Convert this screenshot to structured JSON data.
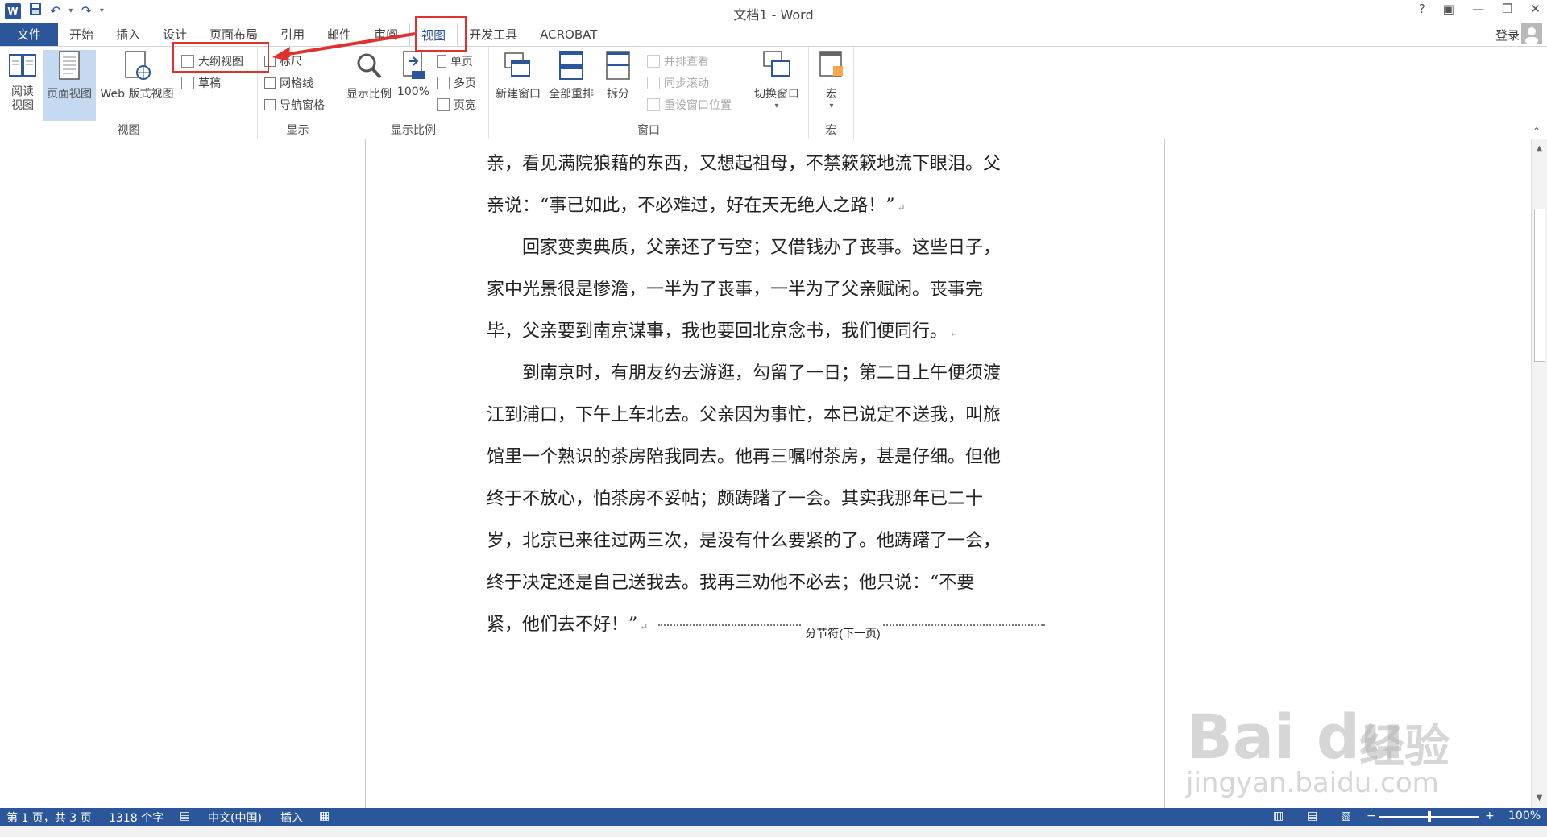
{
  "title_bar": {
    "window_title": "文档1 - Word",
    "help": "?",
    "ribbon_display": "▣",
    "minimize": "—",
    "restore": "❐",
    "close": "✕",
    "qat_undo": "↶",
    "qat_redo": "↷",
    "qat_customize": "▾",
    "logo_letter": "W"
  },
  "tabs": {
    "file": "文件",
    "items": [
      "开始",
      "插入",
      "设计",
      "页面布局",
      "引用",
      "邮件",
      "审阅",
      "视图",
      "开发工具",
      "ACROBAT"
    ],
    "active": "视图",
    "login": "登录"
  },
  "ribbon": {
    "views_group": {
      "label": "视图",
      "read_mode": "阅读\n视图",
      "print_layout": "页面视图",
      "web_layout": "Web 版式视图",
      "outline": "大纲视图",
      "draft": "草稿"
    },
    "show_group": {
      "label": "显示",
      "ruler": "标尺",
      "gridlines": "网格线",
      "nav_pane": "导航窗格"
    },
    "zoom_group": {
      "label": "显示比例",
      "zoom": "显示比例",
      "hundred": "100%",
      "one_page": "单页",
      "multi_page": "多页",
      "page_width": "页宽"
    },
    "window_group": {
      "label": "窗口",
      "new_window": "新建窗口",
      "arrange_all": "全部重排",
      "split": "拆分",
      "side_by_side": "并排查看",
      "sync_scroll": "同步滚动",
      "reset_position": "重设窗口位置",
      "switch_windows": "切换窗口"
    },
    "macros_group": {
      "label": "宏",
      "macros": "宏"
    }
  },
  "document": {
    "lines": [
      "亲，看见满院狼藉的东西，又想起祖母，不禁簌簌地流下眼泪。父",
      "亲说：“事已如此，不必难过，好在天无绝人之路！”",
      "　　回家变卖典质，父亲还了亏空；又借钱办了丧事。这些日子，",
      "家中光景很是惨澹，一半为了丧事，一半为了父亲赋闲。丧事完",
      "毕，父亲要到南京谋事，我也要回北京念书，我们便同行。",
      "　　到南京时，有朋友约去游逛，勾留了一日；第二日上午便须渡",
      "江到浦口，下午上车北去。父亲因为事忙，本已说定不送我，叫旅",
      "馆里一个熟识的茶房陪我同去。他再三嘱咐茶房，甚是仔细。但他",
      "终于不放心，怕茶房不妥帖；颇踌躇了一会。其实我那年已二十",
      "岁，北京已来往过两三次，是没有什么要紧的了。他踌躇了一会，",
      "终于决定还是自己送我去。我再三劝他不必去；他只说：“不要",
      "紧，他们去不好！”"
    ],
    "paragraph_mark": "↵",
    "section_break": "分节符(下一页)"
  },
  "status_bar": {
    "page": "第 1 页，共 3 页",
    "words": "1318 个字",
    "language": "中文(中国)",
    "mode": "插入",
    "zoom_minus": "−",
    "zoom_plus": "+",
    "zoom": "100%",
    "zoom_level": 0.5
  },
  "watermark": {
    "brand": "Bai du",
    "chinese": "经验",
    "url": "jingyan.baidu.com"
  },
  "colors": {
    "accent": "#2b579a",
    "highlight": "#e03131"
  }
}
